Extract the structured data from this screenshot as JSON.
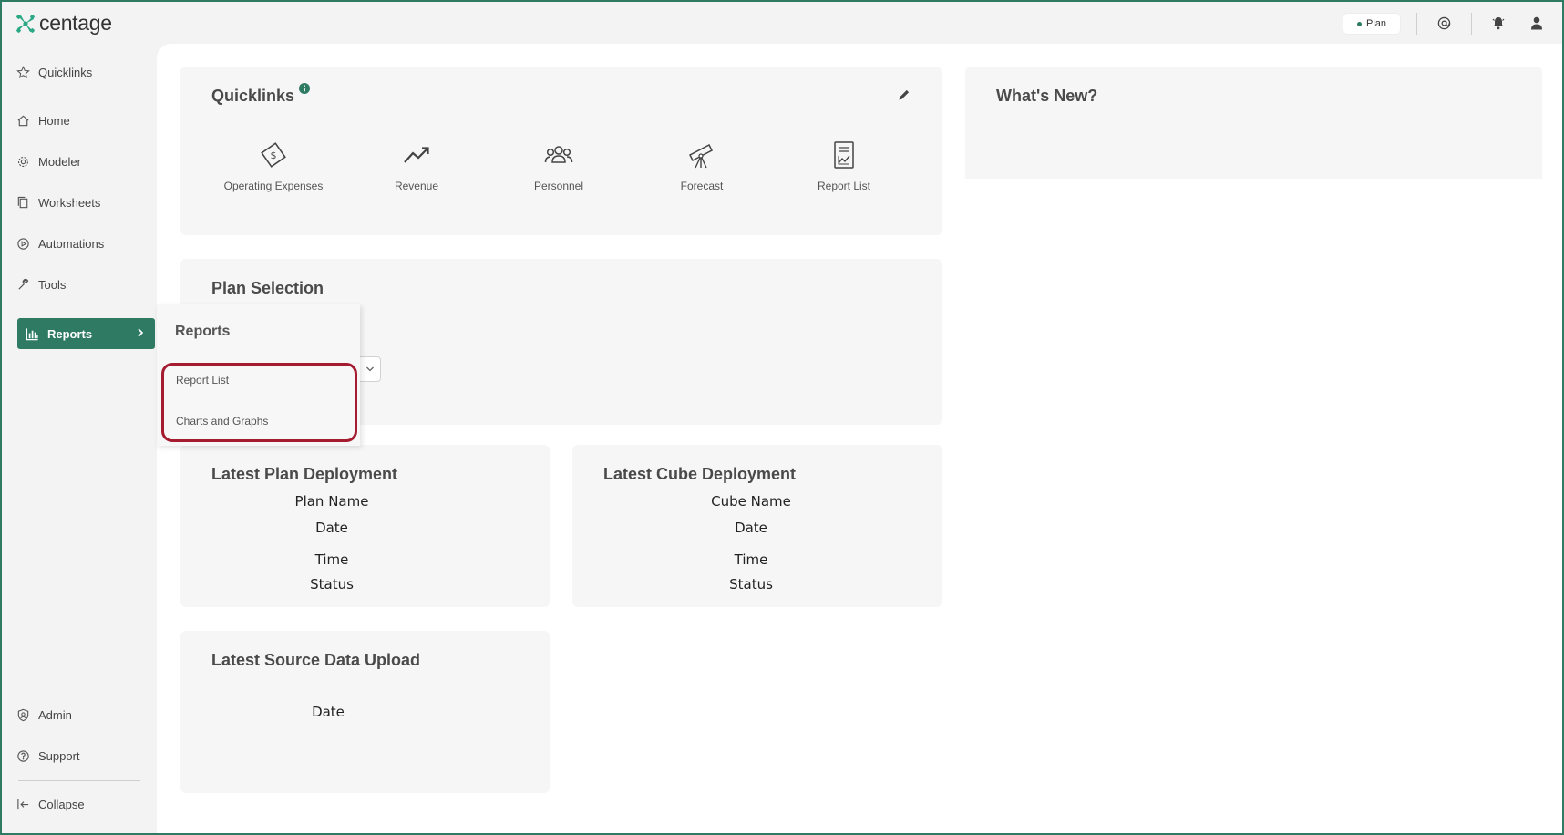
{
  "brand": {
    "name": "centage",
    "accent": "#2f7a63"
  },
  "topbar": {
    "plan_label": "Plan",
    "icons": [
      "at-icon",
      "bell-icon",
      "user-icon"
    ]
  },
  "sidebar": {
    "quicklinks": "Quicklinks",
    "home": "Home",
    "modeler": "Modeler",
    "worksheets": "Worksheets",
    "automations": "Automations",
    "tools": "Tools",
    "reports": "Reports",
    "admin": "Admin",
    "support": "Support",
    "collapse": "Collapse"
  },
  "quicklinks": {
    "title": "Quicklinks",
    "items": [
      {
        "label": "Operating Expenses",
        "icon": "money-icon"
      },
      {
        "label": "Revenue",
        "icon": "trend-up-icon"
      },
      {
        "label": "Personnel",
        "icon": "people-icon"
      },
      {
        "label": "Forecast",
        "icon": "telescope-icon"
      },
      {
        "label": "Report List",
        "icon": "report-icon"
      }
    ]
  },
  "whats_new": {
    "title": "What's New?"
  },
  "plan_selection": {
    "title": "Plan Selection"
  },
  "plan_deployment": {
    "title": "Latest Plan Deployment",
    "name_label": "Plan Name",
    "date_label": "Date",
    "time_label": "Time",
    "status_label": "Status"
  },
  "cube_deployment": {
    "title": "Latest Cube Deployment",
    "name_label": "Cube Name",
    "date_label": "Date",
    "time_label": "Time",
    "status_label": "Status"
  },
  "source_upload": {
    "title": "Latest Source Data Upload",
    "date_label": "Date"
  },
  "reports_flyout": {
    "title": "Reports",
    "items": [
      "Report List",
      "Charts and Graphs"
    ]
  }
}
